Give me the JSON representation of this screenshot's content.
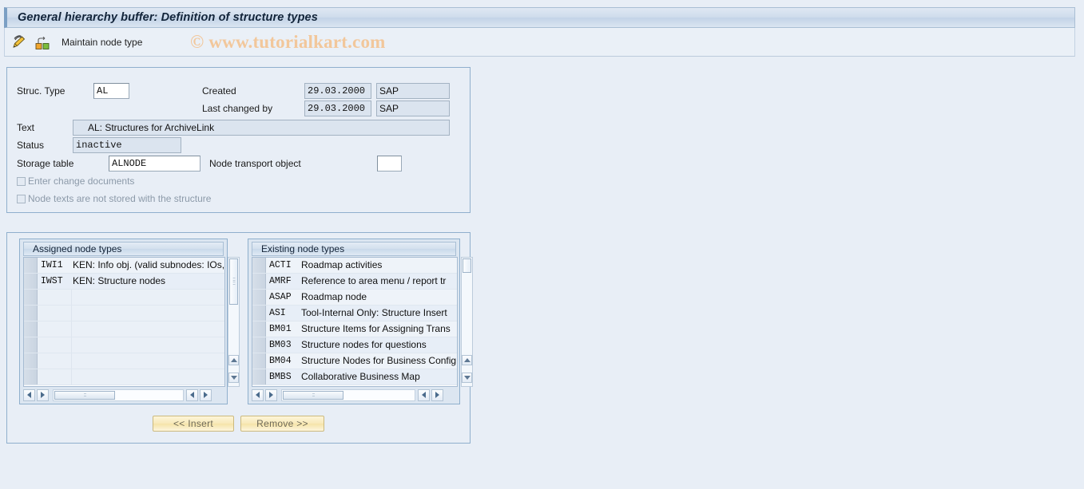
{
  "window": {
    "title": "General hierarchy buffer: Definition of structure types"
  },
  "toolbar": {
    "icons": [
      {
        "name": "edit-pencil-icon"
      },
      {
        "name": "node-hierarchy-icon"
      }
    ],
    "label": "Maintain node type"
  },
  "watermark": {
    "text": "© www.tutorialkart.com",
    "color": "#f2c79b"
  },
  "form": {
    "struc_type_label": "Struc. Type",
    "struc_type_value": "AL",
    "created_label": "Created",
    "created_date": "29.03.2000",
    "created_by": "SAP",
    "last_changed_label": "Last changed by",
    "last_changed_date": "29.03.2000",
    "last_changed_by": "SAP",
    "text_label": "Text",
    "text_value": "AL: Structures for ArchiveLink",
    "status_label": "Status",
    "status_value": "inactive",
    "storage_table_label": "Storage table",
    "storage_table_value": "ALNODE",
    "node_transport_label": "Node transport object",
    "node_transport_value": "",
    "checkboxes": [
      {
        "label": "Enter change documents",
        "checked": false,
        "disabled": true
      },
      {
        "label": "Node texts are not stored with the structure",
        "checked": false,
        "disabled": true
      }
    ]
  },
  "assigned_panel": {
    "header": "Assigned node types",
    "rows": [
      {
        "code": "IWI1",
        "desc": "KEN: Info obj. (valid subnodes: IOs,"
      },
      {
        "code": "IWST",
        "desc": "KEN: Structure nodes"
      }
    ],
    "blank_rows": 6
  },
  "existing_panel": {
    "header": "Existing node types",
    "rows": [
      {
        "code": "ACTI",
        "desc": "Roadmap activities"
      },
      {
        "code": "AMRF",
        "desc": "Reference to area menu / report tr"
      },
      {
        "code": "ASAP",
        "desc": "Roadmap node"
      },
      {
        "code": "ASI",
        "desc": "Tool-Internal Only: Structure Insert"
      },
      {
        "code": "BM01",
        "desc": "Structure Items for Assigning Trans"
      },
      {
        "code": "BM03",
        "desc": "Structure nodes for questions"
      },
      {
        "code": "BM04",
        "desc": "Structure Nodes for Business Config"
      },
      {
        "code": "BMBS",
        "desc": "Collaborative Business Map"
      }
    ],
    "blank_rows": 0
  },
  "buttons": {
    "insert": "<< Insert",
    "remove": "Remove >>"
  },
  "colors": {
    "page_background": "#e8eef6",
    "titlebar_accent": "#7b9fc4",
    "button_yellow": "#f8e9b8",
    "panel_border": "#8fafcd"
  }
}
